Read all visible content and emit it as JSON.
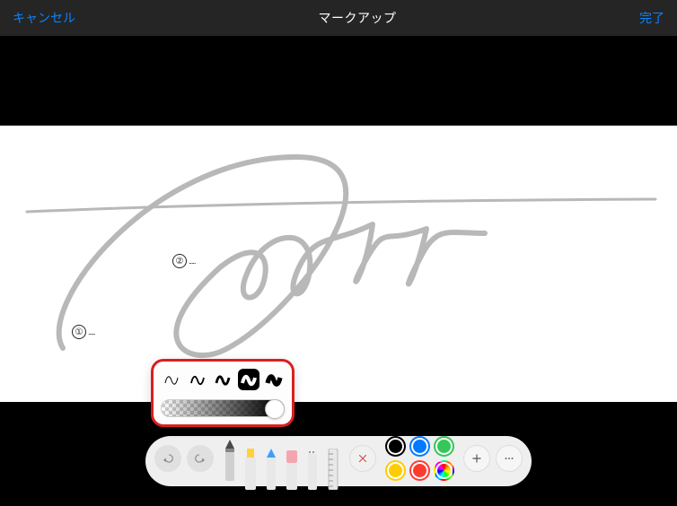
{
  "header": {
    "cancel": "キャンセル",
    "title": "マークアップ",
    "done": "完了"
  },
  "annotations": {
    "label1": "①",
    "label2": "②",
    "dots": "....."
  },
  "popover": {
    "stroke_options": [
      {
        "weight": 1.0,
        "selected": false
      },
      {
        "weight": 1.8,
        "selected": false
      },
      {
        "weight": 2.8,
        "selected": false
      },
      {
        "weight": 4.0,
        "selected": true
      },
      {
        "weight": 5.2,
        "selected": false
      }
    ],
    "opacity": 1.0
  },
  "toolbar": {
    "undo_enabled": false,
    "redo_enabled": false,
    "tools": [
      {
        "name": "pen",
        "tip": "#4a4a4a",
        "body": "#cfcfcf",
        "shape": "pen",
        "selected": true
      },
      {
        "name": "marker",
        "tip": "#ffd23a",
        "body": "#e8e8e8",
        "shape": "marker",
        "selected": false
      },
      {
        "name": "pencil",
        "tip": "#3aa0ff",
        "body": "#e8e8e8",
        "shape": "pencil",
        "selected": false
      },
      {
        "name": "eraser",
        "tip": "#f2a7b0",
        "body": "#e8e8e8",
        "shape": "eraser",
        "selected": false
      },
      {
        "name": "lasso",
        "tip": "#b8b8b8",
        "body": "#e8e8e8",
        "shape": "lasso",
        "selected": false
      },
      {
        "name": "ruler",
        "tip": "#d8d8d8",
        "body": "#e8e8e8",
        "shape": "ruler",
        "selected": false
      }
    ],
    "close_tools": true,
    "colors": [
      {
        "name": "black",
        "hex": "#000000",
        "selected": true
      },
      {
        "name": "blue",
        "hex": "#007aff",
        "selected": false
      },
      {
        "name": "green",
        "hex": "#34c759",
        "selected": false
      },
      {
        "name": "yellow",
        "hex": "#ffcc00",
        "selected": false
      },
      {
        "name": "red",
        "hex": "#ff3b30",
        "selected": false
      },
      {
        "name": "picker",
        "hex": "rainbow",
        "selected": false
      }
    ]
  }
}
